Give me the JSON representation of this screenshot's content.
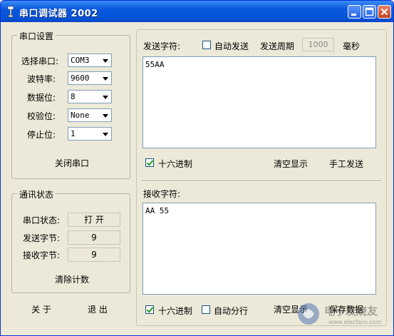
{
  "window": {
    "title": "串口调试器 2002"
  },
  "serial_settings": {
    "group_label": "串口设置",
    "rows": [
      {
        "label": "选择串口:",
        "value": "COM3"
      },
      {
        "label": "波特率:",
        "value": "9600"
      },
      {
        "label": "数据位:",
        "value": "8"
      },
      {
        "label": "校验位:",
        "value": "None"
      },
      {
        "label": "停止位:",
        "value": "1"
      }
    ],
    "close_port_label": "关闭串口"
  },
  "comm_status": {
    "group_label": "通讯状态",
    "port_status_label": "串口状态:",
    "port_status_value": "打 开",
    "sent_bytes_label": "发送字节:",
    "sent_bytes_value": "9",
    "recv_bytes_label": "接收字节:",
    "recv_bytes_value": "9",
    "clear_count_label": "清除计数"
  },
  "bottom_left": {
    "about_label": "关 于",
    "exit_label": "退 出"
  },
  "send": {
    "label": "发送字符:",
    "auto_send_label": "自动发送",
    "auto_send_checked": false,
    "period_label": "发送周期",
    "period_value": "1000",
    "period_unit": "毫秒",
    "text": "55AA",
    "hex_label": "十六进制",
    "hex_checked": true,
    "clear_display_label": "清空显示",
    "manual_send_label": "手工发送"
  },
  "receive": {
    "label": "接收字符:",
    "text": "AA 55",
    "hex_label": "十六进制",
    "hex_checked": true,
    "auto_wrap_label": "自动分行",
    "auto_wrap_checked": false,
    "clear_label": "清空显示",
    "save_label": "保存数据"
  },
  "watermark": {
    "text": "电子发烧友",
    "url": "www.elecfans.com"
  },
  "colors": {
    "titlebar": "#0553d6",
    "face": "#ece9d8",
    "check": "#21a121"
  }
}
